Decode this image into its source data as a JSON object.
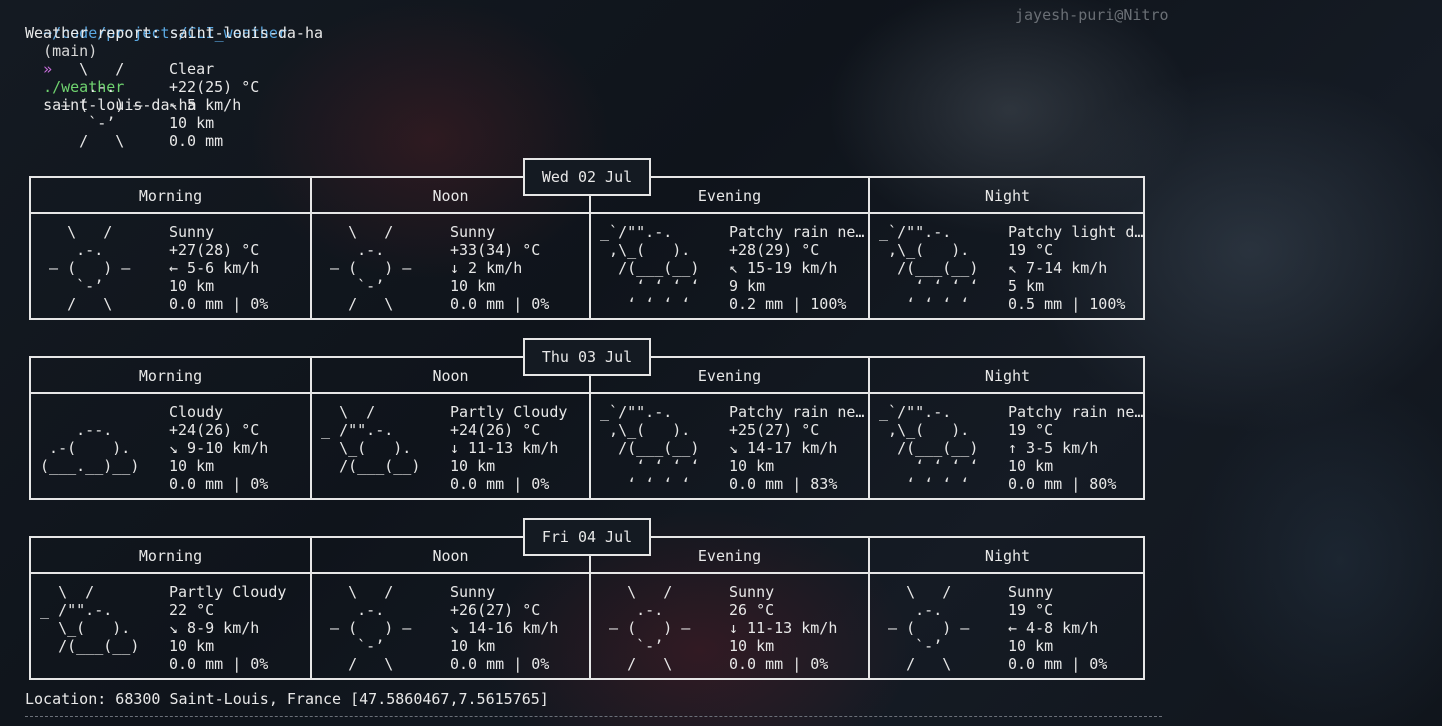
{
  "terminal": {
    "prompt_path": "~/code/projects/CLI_weather",
    "prompt_branch": "(main)",
    "prompt_arrow": "»",
    "command": "./weather",
    "argument": "saint-louis-da-ha",
    "hostname": "jayesh-puri@Nitro"
  },
  "report": {
    "title": "Weather report: saint-louis-da-ha",
    "current": {
      "icon": "      \\   /   \n       .-.    \n    ― (   ) ― \n       `-’    \n      /   \\   ",
      "condition": "Clear",
      "temperature": "+22(25) °C",
      "wind": "↖ 5 km/h",
      "visibility": "10 km",
      "precipitation": "0.0 mm"
    },
    "days": [
      {
        "label": "Wed 02 Jul",
        "periods": [
          {
            "name": "Morning",
            "icon": "    \\   /   \n     .-.    \n  ― (   ) ― \n     `-’    \n    /   \\   ",
            "condition": "Sunny",
            "temperature": "+27(28) °C",
            "wind": "← 5-6 km/h",
            "visibility": "10 km",
            "precipitation": "0.0 mm | 0%"
          },
          {
            "name": "Noon",
            "icon": "    \\   /   \n     .-.    \n  ― (   ) ― \n     `-’    \n    /   \\   ",
            "condition": "Sunny",
            "temperature": "+33(34) °C",
            "wind": "↓ 2 km/h",
            "visibility": "10 km",
            "precipitation": "0.0 mm | 0%"
          },
          {
            "name": "Evening",
            "icon": " _`/\"\".-.   \n  ,\\_(   ).  \n   /(___(__) \n     ‘ ‘ ‘ ‘ \n    ‘ ‘ ‘ ‘  ",
            "condition": "Patchy rain ne…",
            "temperature": "+28(29) °C",
            "wind": "↖ 15-19 km/h",
            "visibility": "9 km",
            "precipitation": "0.2 mm | 100%"
          },
          {
            "name": "Night",
            "icon": " _`/\"\".-.   \n  ,\\_(   ).  \n   /(___(__) \n     ‘ ‘ ‘ ‘ \n    ‘ ‘ ‘ ‘  ",
            "condition": "Patchy light d…",
            "temperature": "19 °C",
            "wind": "↖ 7-14 km/h",
            "visibility": "5 km",
            "precipitation": "0.5 mm | 100%"
          }
        ]
      },
      {
        "label": "Thu 03 Jul",
        "periods": [
          {
            "name": "Morning",
            "icon": "            \n     .--.   \n  .-(    ). \n (___.__)__)\n            ",
            "condition": "Cloudy",
            "temperature": "+24(26) °C",
            "wind": "↘ 9-10 km/h",
            "visibility": "10 km",
            "precipitation": "0.0 mm | 0%"
          },
          {
            "name": "Noon",
            "icon": "   \\  /     \n _ /\"\".-.   \n   \\_(   ).  \n   /(___(__) \n            ",
            "condition": "Partly Cloudy",
            "temperature": "+24(26) °C",
            "wind": "↓ 11-13 km/h",
            "visibility": "10 km",
            "precipitation": "0.0 mm | 0%"
          },
          {
            "name": "Evening",
            "icon": " _`/\"\".-.   \n  ,\\_(   ).  \n   /(___(__) \n     ‘ ‘ ‘ ‘ \n    ‘ ‘ ‘ ‘  ",
            "condition": "Patchy rain ne…",
            "temperature": "+25(27) °C",
            "wind": "↘ 14-17 km/h",
            "visibility": "10 km",
            "precipitation": "0.0 mm | 83%"
          },
          {
            "name": "Night",
            "icon": " _`/\"\".-.   \n  ,\\_(   ).  \n   /(___(__) \n     ‘ ‘ ‘ ‘ \n    ‘ ‘ ‘ ‘  ",
            "condition": "Patchy rain ne…",
            "temperature": "19 °C",
            "wind": "↑ 3-5 km/h",
            "visibility": "10 km",
            "precipitation": "0.0 mm | 80%"
          }
        ]
      },
      {
        "label": "Fri 04 Jul",
        "periods": [
          {
            "name": "Morning",
            "icon": "   \\  /     \n _ /\"\".-.   \n   \\_(   ).  \n   /(___(__) \n            ",
            "condition": "Partly Cloudy",
            "temperature": "22 °C",
            "wind": "↘ 8-9 km/h",
            "visibility": "10 km",
            "precipitation": "0.0 mm | 0%"
          },
          {
            "name": "Noon",
            "icon": "    \\   /   \n     .-.    \n  ― (   ) ― \n     `-’    \n    /   \\   ",
            "condition": "Sunny",
            "temperature": "+26(27) °C",
            "wind": "↘ 14-16 km/h",
            "visibility": "10 km",
            "precipitation": "0.0 mm | 0%"
          },
          {
            "name": "Evening",
            "icon": "    \\   /   \n     .-.    \n  ― (   ) ― \n     `-’    \n    /   \\   ",
            "condition": "Sunny",
            "temperature": "26 °C",
            "wind": "↓ 11-13 km/h",
            "visibility": "10 km",
            "precipitation": "0.0 mm | 0%"
          },
          {
            "name": "Night",
            "icon": "    \\   /   \n     .-.    \n  ― (   ) ― \n     `-’    \n    /   \\   ",
            "condition": "Sunny",
            "temperature": "19 °C",
            "wind": "← 4-8 km/h",
            "visibility": "10 km",
            "precipitation": "0.0 mm | 0%"
          }
        ]
      }
    ],
    "location": "Location: 68300 Saint-Louis, France [47.5860467,7.5615765]"
  }
}
